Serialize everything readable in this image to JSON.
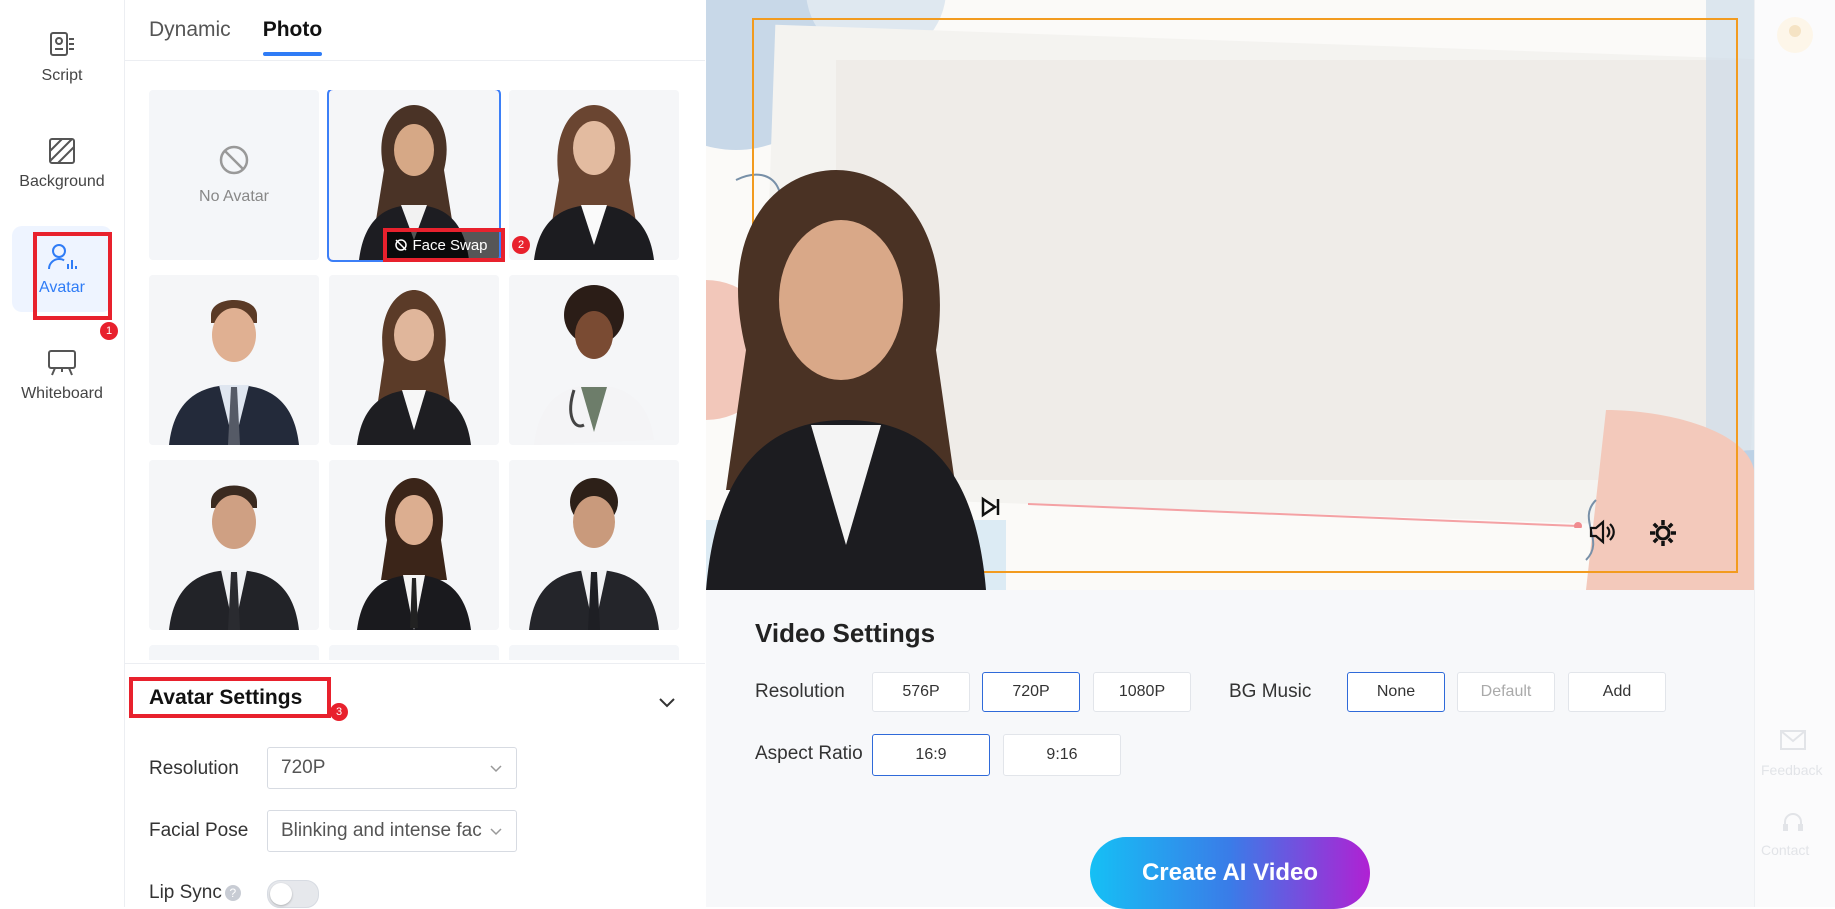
{
  "sidebar": {
    "items": [
      {
        "label": "Script",
        "icon": "script-icon"
      },
      {
        "label": "Background",
        "icon": "background-icon"
      },
      {
        "label": "Avatar",
        "icon": "avatar-icon",
        "active": true
      },
      {
        "label": "Whiteboard",
        "icon": "whiteboard-icon"
      }
    ]
  },
  "tabs": [
    {
      "label": "Dynamic",
      "active": false
    },
    {
      "label": "Photo",
      "active": true
    }
  ],
  "avatar_grid": {
    "no_avatar_label": "No Avatar",
    "face_swap_label": "Face Swap",
    "selected_index": 1
  },
  "callouts": {
    "one": "1",
    "two": "2",
    "three": "3"
  },
  "avatar_settings": {
    "title": "Avatar Settings",
    "resolution_label": "Resolution",
    "resolution_value": "720P",
    "facial_pose_label": "Facial Pose",
    "facial_pose_value": "Blinking and intense fac",
    "lip_sync_label": "Lip Sync",
    "lip_sync_on": false
  },
  "video_settings": {
    "title": "Video Settings",
    "resolution_label": "Resolution",
    "resolution_options": [
      "576P",
      "720P",
      "1080P"
    ],
    "resolution_selected": "720P",
    "bg_music_label": "BG Music",
    "bg_music_options": [
      "None",
      "Default",
      "Add"
    ],
    "bg_music_selected": "None",
    "aspect_ratio_label": "Aspect Ratio",
    "aspect_ratio_options": [
      "16:9",
      "9:16"
    ],
    "aspect_ratio_selected": "16:9",
    "create_button": "Create AI Video"
  },
  "right_strip": {
    "feedback_label": "Feedback",
    "contact_label": "Contact"
  },
  "colors": {
    "accent": "#2f7cf6",
    "callout": "#e8212d",
    "frame": "#f29b1f"
  }
}
